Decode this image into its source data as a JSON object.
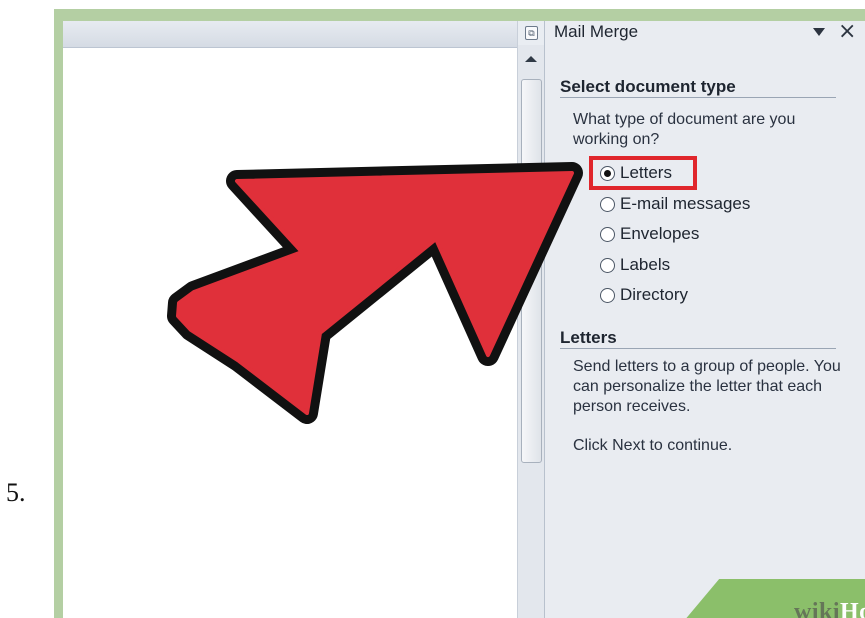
{
  "step": {
    "number": "5."
  },
  "task_pane": {
    "title": "Mail Merge",
    "menu_icon": "dropdown-triangle",
    "close_icon": "close-x",
    "select_section": {
      "heading": "Select document type",
      "question": "What type of document are you working on?",
      "options": [
        {
          "label": "Letters",
          "checked": true,
          "highlighted": true
        },
        {
          "label": "E-mail messages",
          "checked": false
        },
        {
          "label": "Envelopes",
          "checked": false
        },
        {
          "label": "Labels",
          "checked": false
        },
        {
          "label": "Directory",
          "checked": false
        }
      ]
    },
    "info_section": {
      "heading": "Letters",
      "description": "Send letters to a group of people. You can personalize the letter that each person receives.",
      "instruction": "Click Next to continue."
    }
  },
  "annotation": {
    "arrow_color": "#e0303a",
    "highlight_color": "#e0262c",
    "outline_color": "#111111"
  },
  "watermark": {
    "part_a": "wiki",
    "part_b": "How"
  },
  "colors": {
    "frame_green": "#b4cfa3",
    "pane_bg": "#e9ecf1"
  }
}
